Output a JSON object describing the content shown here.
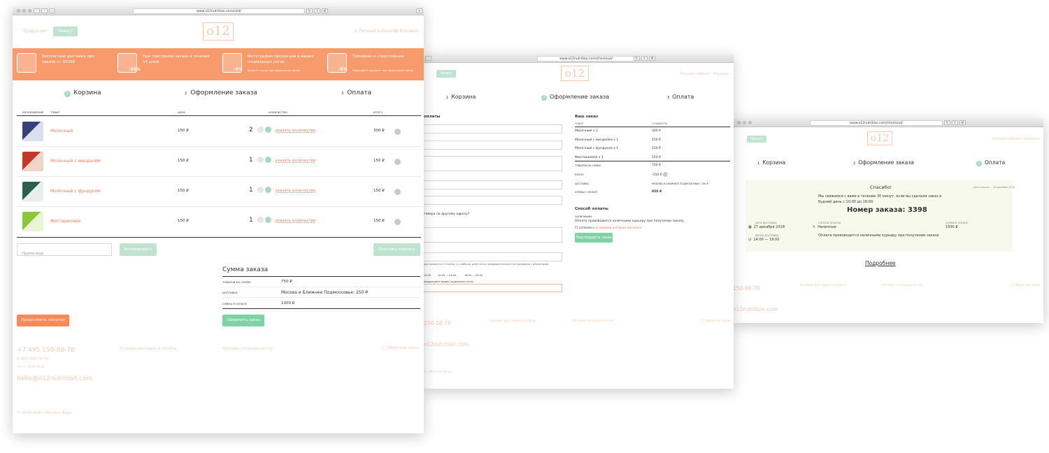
{
  "win1": {
    "url": "www.o12nutrition.com/cart/",
    "nav": {
      "products": "Продукция",
      "checkout": "Чекаут",
      "account": "Личный кабинет",
      "cart": "Корзина"
    },
    "logo": "o12",
    "banner": [
      {
        "text": "Бесплатная доставка при заказе от 3000₽",
        "icon": "free-box-icon"
      },
      {
        "text": "При повторном заказе в течение 14 дней",
        "icon": "calendar-discount-icon",
        "badge": "-10%"
      },
      {
        "text": "Фотография продукции в ваших социальных сетях",
        "sub": "Введите ссылку при оформлении заказа",
        "icon": "photo-discount-icon",
        "badge": "-5%"
      },
      {
        "text": "Тренерам и спортсменам",
        "sub": "Предъявите документ при оформлении заказа",
        "icon": "medal-discount-icon",
        "badge": "-5%"
      }
    ],
    "steps": [
      {
        "num": "1",
        "label": "Корзина"
      },
      {
        "num": "2",
        "label": "Оформление заказа"
      },
      {
        "num": "3",
        "label": "Оплата"
      }
    ],
    "table": {
      "headers": {
        "image": "ИЗОБРАЖЕНИЕ",
        "product": "ТОВАР",
        "price": "ЦЕНА",
        "qty": "КОЛИЧЕСТВО",
        "total": "ИТОГО"
      },
      "rows": [
        {
          "name": "Молочный",
          "price": "150 ₽",
          "qty": "2",
          "qty_link": "указать количество",
          "total": "300 ₽"
        },
        {
          "name": "Молочный с миндалём",
          "price": "150 ₽",
          "qty": "1",
          "qty_link": "указать количество",
          "total": "150 ₽"
        },
        {
          "name": "Молочный с фундуком",
          "price": "150 ₽",
          "qty": "1",
          "qty_link": "указать количество",
          "total": "150 ₽"
        },
        {
          "name": "Фисташковое",
          "price": "150 ₽",
          "qty": "1",
          "qty_link": "указать количество",
          "total": "150 ₽"
        }
      ]
    },
    "promo_placeholder": "Промо-код",
    "activate": "Активировать",
    "clear_cart": "Очистить корзину",
    "summary": {
      "title": "Сумма заказа",
      "rows": [
        {
          "label": "ТОВАРОВ НА СУММУ",
          "value": "750 ₽"
        },
        {
          "label": "ДОСТАВКА",
          "value": "Москва и Ближнее Подмосковье: 250 ₽"
        },
        {
          "label": "СУММА К ОПЛАТЕ",
          "value": "1000 ₽"
        }
      ]
    },
    "continue": "Продолжить покупки",
    "checkout_btn": "Оформить заказ",
    "footer": {
      "phone": "+7 495 150-88-78",
      "phone2": "8 800 350 78 75",
      "hours": "пн–пт: 10:00–18:00",
      "email": "hello@o12nutrition.com",
      "link1": "Условия доставки и оплаты",
      "link2": "Оптовое сотрудничество",
      "feedback": "Обратная связь",
      "copyright": "© 2018 ООО «Молоко Фуд»"
    }
  },
  "win2": {
    "url": "www.o12nutrition.com/checkout/",
    "checkout_btn": "Чекаут",
    "account": "Личный кабинет",
    "cart": "Корзина",
    "steps": [
      {
        "num": "1",
        "label": "Корзина"
      },
      {
        "num": "2",
        "label": "Оформление заказа"
      },
      {
        "num": "3",
        "label": "Оплата"
      }
    ],
    "left_title": "оплаты",
    "other_address": "товара по другому адресу?",
    "delivery_note": "доставляется в течение 2-х рабочих дней после предварительного согласования с оператором.",
    "times": [
      "10:00",
      "12:00 — 14:00",
      "18:00 — 20:00"
    ],
    "social_label": "продукции в ваших социальных сетях",
    "order": {
      "title": "Ваш заказ",
      "col1": "ТОВАР",
      "col2": "СТОИМОСТЬ",
      "items": [
        {
          "name": "Молочный",
          "qty": "x 2",
          "price": "300 ₽"
        },
        {
          "name": "Молочный с миндалём",
          "qty": "x 1",
          "price": "150 ₽"
        },
        {
          "name": "Молочный с фундуком",
          "qty": "x 1",
          "price": "150 ₽"
        },
        {
          "name": "Фисташковое",
          "qty": "x 1",
          "price": "150 ₽"
        }
      ],
      "goods_label": "ТОВАРОВ НА СУММУ",
      "goods_value": "750 ₽",
      "coupon_label": "КУПОН",
      "coupon_value": "-150 ₽",
      "delivery_label": "ДОСТАВКА",
      "delivery_value": "МОСКВА И БЛИЖНЕЕ ПОДМОСКОВЬЕ: 250 ₽",
      "total_label": "СУММА К ОПЛАТЕ",
      "total_value": "850 ₽"
    },
    "payment": {
      "title": "Способ оплаты",
      "method": "НАЛИЧНЫМИ",
      "desc": "Оплата производится наличными курьеру при получении заказа.",
      "agree_prefix": "согласен с",
      "agree_link": "условиями интернет-магазина",
      "confirm": "Подтвердить заказ"
    },
    "footer": {
      "phone": "150-88-78",
      "email": "o12nutrition.com",
      "link1": "Условия доставки и оплаты",
      "link2": "Оптовое сотрудничество",
      "feedback": "Обратная связь",
      "copyright": "© «Молоко Фуд»"
    }
  },
  "win3": {
    "url": "www.o12nutrition.com/checkout/",
    "checkout_btn": "Чекаут",
    "account": "Личный кабинет",
    "cart": "Корзина",
    "steps": [
      {
        "num": "1",
        "label": "Корзина"
      },
      {
        "num": "2",
        "label": "Оформление заказа"
      },
      {
        "num": "3",
        "label": "Оплата"
      }
    ],
    "thanks": "Спасибо!",
    "date_created": "Дата заказа — 26 декабря 2018",
    "message": "Мы свяжемся с вами в течение 30 минут, если вы сделали заказ в будний день с 10:00 до 18:00.",
    "order_number": "Номер заказа: 3398",
    "delivery_date_label": "ДАТА ДОСТАВКИ",
    "delivery_date": "27 декабря 2018",
    "payment_label": "СПОСОБ ОПЛАТЫ",
    "payment_value": "Наличные",
    "sum_label": "СУММА К ОПЛАТЕ",
    "sum_value": "1930 ₽",
    "time_label": "ВРЕМЯ ДОСТАВКИ",
    "time_value": "14:00 — 18:00",
    "note": "Оплата производится наличными курьеру при получении заказа",
    "more": "Подробнее",
    "footer": {
      "phone": "150-88-78",
      "email": "o12nutrition.com",
      "link1": "Условия доставки и оплаты",
      "link2": "Оптовое сотрудничество",
      "feedback": "Обратная связь"
    }
  },
  "colors": {
    "banner": "#f79a6c",
    "accent_green": "#7fd1a6",
    "accent_orange": "#f58a5a",
    "success_bg": "#f7f9ec"
  }
}
